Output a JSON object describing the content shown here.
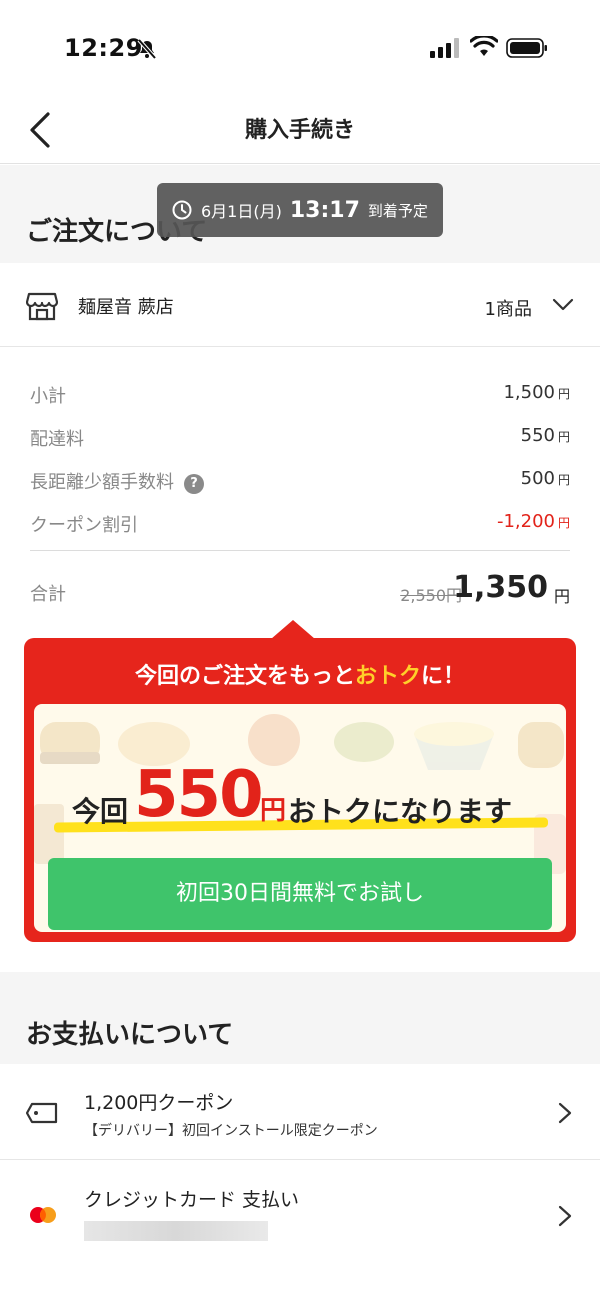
{
  "status_bar": {
    "time": "12:29",
    "icons": [
      "bell-off-icon",
      "signal-icon",
      "wifi-icon",
      "battery-icon"
    ]
  },
  "nav": {
    "title": "購入手続き",
    "back_icon": "chevron-left-icon"
  },
  "order_section": {
    "title": "ご注文について",
    "eta": {
      "date": "6月1日(月)",
      "time": "13:17",
      "label": "到着予定"
    },
    "store": {
      "name": "麺屋音 蕨店",
      "item_count": "1商品",
      "icon": "store-icon"
    }
  },
  "summary": {
    "rows": [
      {
        "label": "小計",
        "value": "1,500",
        "unit": "円"
      },
      {
        "label": "配達料",
        "value": "550",
        "unit": "円"
      },
      {
        "label": "長距離少額手数料",
        "value": "500",
        "unit": "円",
        "help": "?"
      },
      {
        "label": "クーポン割引",
        "value": "-1,200",
        "unit": "円"
      }
    ],
    "total": {
      "label": "合計",
      "old": "2,550円",
      "new": "1,350",
      "unit": "円"
    }
  },
  "promo": {
    "headline_pre": "今回のご注文をもっと",
    "headline_highlight": "おトク",
    "headline_post": "に！",
    "main_pre": "今回",
    "main_amount": "550",
    "main_yen": "円",
    "main_post": "おトクになります",
    "button": "初回30日間無料でお試し"
  },
  "payment_section": {
    "title": "お支払いについて",
    "coupon": {
      "title": "1,200円クーポン",
      "subtitle": "【デリバリー】初回インストール限定クーポン"
    },
    "card": {
      "title": "クレジットカード 支払い"
    }
  },
  "colors": {
    "accent_red": "#e6251c",
    "highlight_yellow": "#ffd02a",
    "button_green": "#3fc46b"
  }
}
